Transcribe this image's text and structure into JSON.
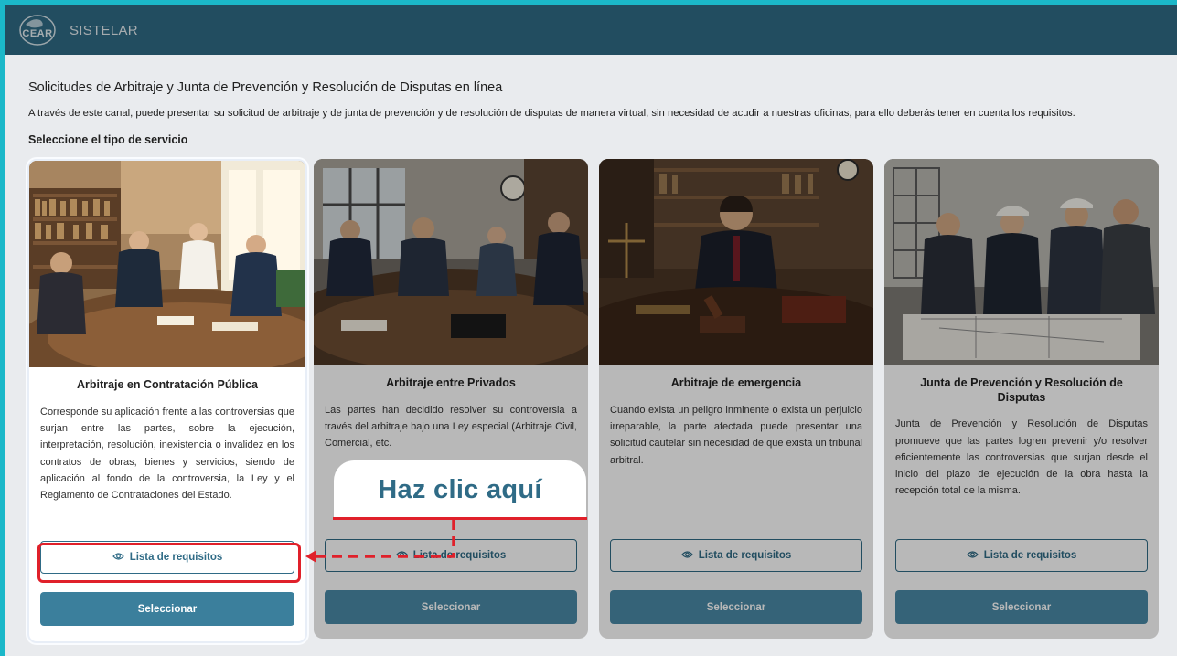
{
  "header": {
    "logo_text": "CEAR",
    "app_name": "SISTELAR"
  },
  "page": {
    "heading": "Solicitudes de Arbitraje y Junta de Prevención y Resolución de Disputas en línea",
    "description": "A través de este canal, puede presentar su solicitud de arbitraje y de junta de prevención y de resolución de disputas de manera virtual, sin necesidad de acudir a nuestras oficinas, para ello deberás tener en cuenta los requisitos.",
    "section_label": "Seleccione el tipo de servicio"
  },
  "cards": [
    {
      "title": "Arbitraje en Contratación Pública",
      "text": "Corresponde su aplicación frente a las controversias que surjan entre las partes, sobre la ejecución, interpretación, resolución, inexistencia o invalidez en los contratos de obras, bienes y servicios, siendo de aplicación al fondo de la controversia, la Ley y el Reglamento de Contrataciones del Estado.",
      "requirements_label": "Lista de requisitos",
      "select_label": "Seleccionar"
    },
    {
      "title": "Arbitraje entre Privados",
      "text": "Las partes han decidido resolver su controversia a través del arbitraje bajo una Ley especial (Arbitraje Civil, Comercial, etc.",
      "requirements_label": "Lista de requisitos",
      "select_label": "Seleccionar"
    },
    {
      "title": "Arbitraje de emergencia",
      "text": "Cuando exista un peligro inminente o exista un perjuicio irreparable, la parte afectada puede presentar una solicitud cautelar sin necesidad de que exista un tribunal arbitral.",
      "requirements_label": "Lista de requisitos",
      "select_label": "Seleccionar"
    },
    {
      "title": "Junta de Prevención y Resolución de Disputas",
      "text": "Junta de Prevención y Resolución de Disputas promueve que las partes logren prevenir y/o resolver eficientemente las controversias que surjan desde el inicio del plazo de ejecución de la obra hasta la recepción total de la misma.",
      "requirements_label": "Lista de requisitos",
      "select_label": "Seleccionar"
    }
  ],
  "callout": {
    "text": "Haz clic aquí"
  },
  "colors": {
    "brand": "#2f6b86",
    "accent_frame": "#1bb8c9",
    "highlight": "#e0202a"
  }
}
